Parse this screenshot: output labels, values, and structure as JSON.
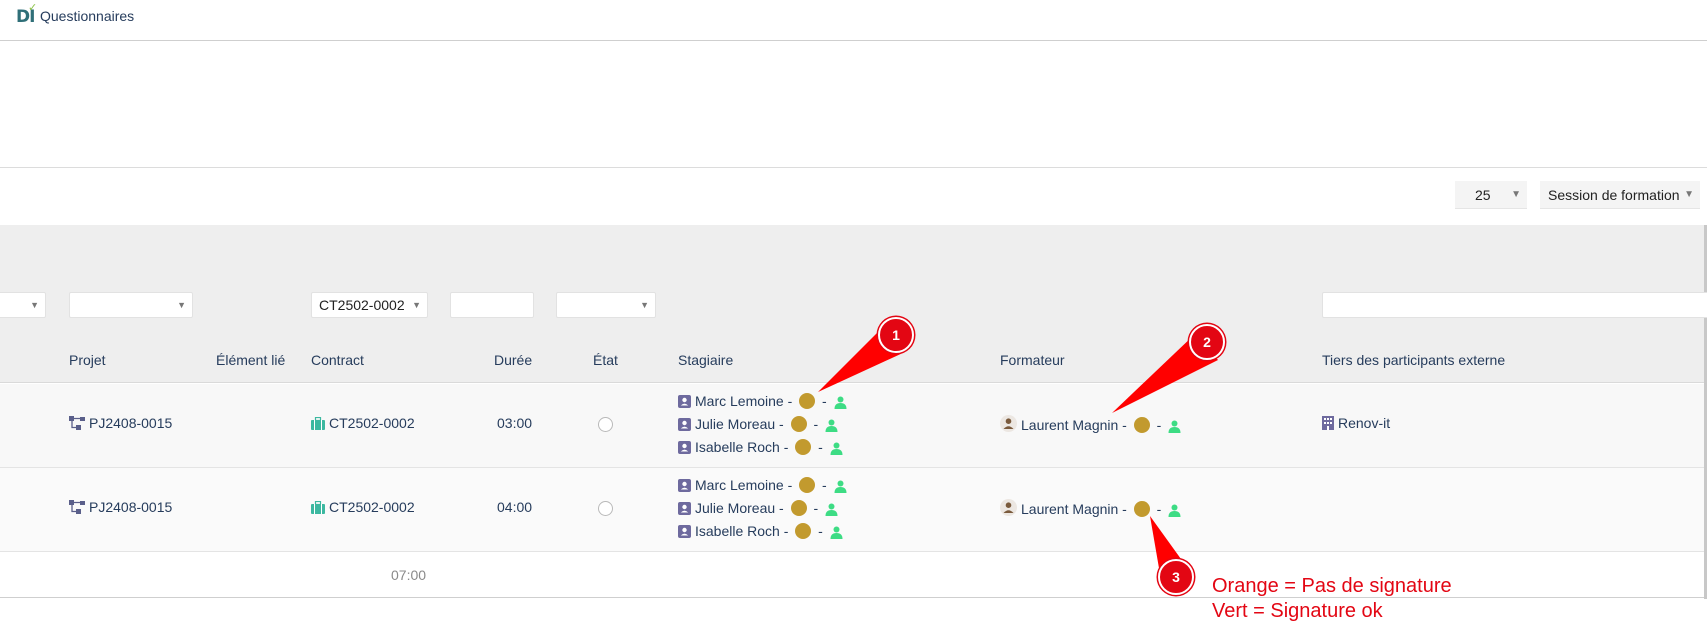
{
  "app": {
    "title": "Questionnaires"
  },
  "toolbar": {
    "page_size": "25",
    "mode": "Session de formation"
  },
  "filters": {
    "contract_value": "CT2502-0002"
  },
  "columns": {
    "projet": "Projet",
    "element_lie": "Élément lié",
    "contract": "Contract",
    "duree": "Durée",
    "etat": "État",
    "stagiaire": "Stagiaire",
    "formateur": "Formateur",
    "tiers": "Tiers des participants externe"
  },
  "rows": [
    {
      "projet": "PJ2408-0015",
      "contract": "CT2502-0002",
      "duree": "03:00",
      "stagiaires": [
        "Marc Lemoine",
        "Julie Moreau",
        "Isabelle Roch"
      ],
      "formateur": "Laurent Magnin",
      "tiers": "Renov-it"
    },
    {
      "projet": "PJ2408-0015",
      "contract": "CT2502-0002",
      "duree": "04:00",
      "stagiaires": [
        "Marc Lemoine",
        "Julie Moreau",
        "Isabelle Roch"
      ],
      "formateur": "Laurent Magnin",
      "tiers": ""
    }
  ],
  "totals": {
    "duree": "07:00"
  },
  "annotations": {
    "badges": [
      "1",
      "2",
      "3"
    ],
    "legend_line1": "Orange = Pas de signature",
    "legend_line2": "Vert = Signature ok",
    "color_orange": "#c29a2e",
    "color_green": "#3ddc84",
    "color_red": "#e30613"
  },
  "icons": {
    "project": "project-tree-icon",
    "contract": "briefcase-icon",
    "stagiaire": "contact-card-icon",
    "formateur": "user-avatar-icon",
    "tiers": "building-icon",
    "signature_status": "user-icon"
  },
  "separator": " - "
}
